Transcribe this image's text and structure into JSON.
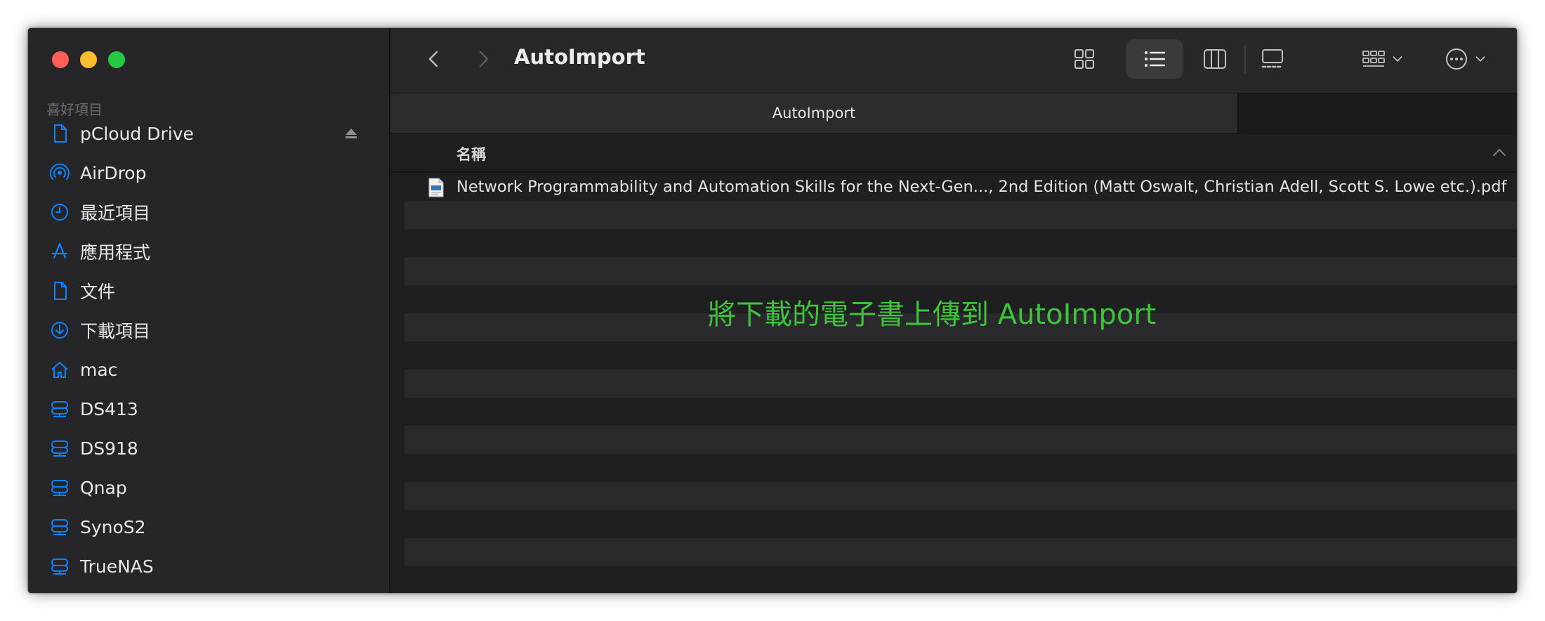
{
  "window": {
    "title": "AutoImport"
  },
  "sidebar": {
    "section_title": "喜好項目",
    "items": [
      {
        "label": "pCloud Drive",
        "icon": "document-icon"
      },
      {
        "label": "AirDrop",
        "icon": "airdrop-icon"
      },
      {
        "label": "最近項目",
        "icon": "clock-icon"
      },
      {
        "label": "應用程式",
        "icon": "applications-icon"
      },
      {
        "label": "文件",
        "icon": "document-icon"
      },
      {
        "label": "下載項目",
        "icon": "download-icon"
      },
      {
        "label": "mac",
        "icon": "home-icon"
      },
      {
        "label": "DS413",
        "icon": "server-icon"
      },
      {
        "label": "DS918",
        "icon": "server-icon"
      },
      {
        "label": "Qnap",
        "icon": "server-icon"
      },
      {
        "label": "SynoS2",
        "icon": "server-icon"
      },
      {
        "label": "TrueNAS",
        "icon": "server-icon"
      }
    ]
  },
  "toolbar": {
    "view_modes": [
      "icon-view",
      "list-view",
      "column-view",
      "gallery-view"
    ],
    "active_view": "list-view"
  },
  "tabs": [
    {
      "label": "AutoImport",
      "active": true
    }
  ],
  "list": {
    "column_name": "名稱",
    "files": [
      {
        "name": "Network Programmability and Automation Skills for the Next-Gen..., 2nd Edition (Matt Oswalt, Christian Adell, Scott S. Lowe etc.).pdf",
        "icon": "pdf-icon"
      }
    ]
  },
  "annotation": "將下載的電子書上傳到 AutoImport",
  "colors": {
    "accent": "#0a84ff",
    "annotation": "#3ec43c",
    "close": "#ff5f57",
    "minimize": "#febc2e",
    "maximize": "#28c840"
  }
}
